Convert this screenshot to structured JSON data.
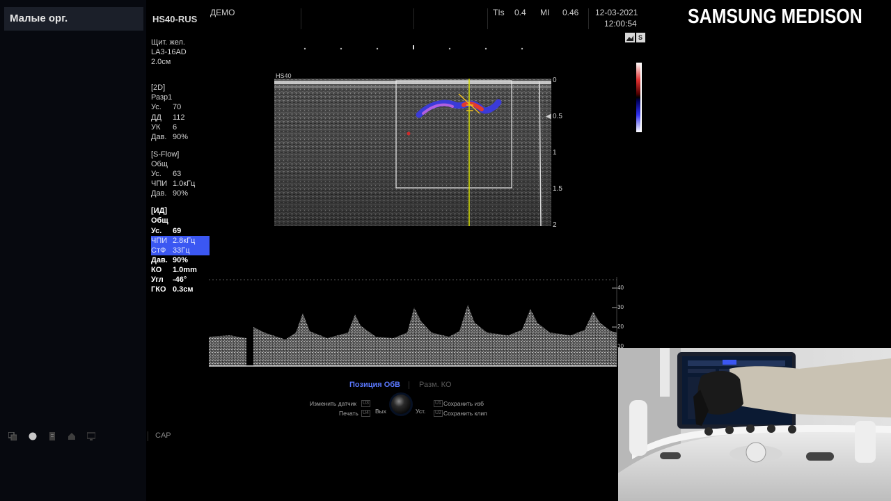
{
  "sidebar": {
    "preset": "Малые орг."
  },
  "header": {
    "model": "HS40-RUS",
    "mode": "ДЕМО",
    "tis_label": "TIs",
    "tis_value": "0.4",
    "mi_label": "MI",
    "mi_value": "0.46",
    "date": "12-03-2021",
    "time": "12:00:54",
    "image_label": "HS40"
  },
  "brand": {
    "logo": "SAMSUNG MEDISON"
  },
  "exam": {
    "organ": "Щит. жел.",
    "probe": "LA3-16AD",
    "depth": "2.0см"
  },
  "params": {
    "b2d": {
      "title": "[2D]",
      "line1": "Разр1",
      "rows": [
        {
          "k": "Ус.",
          "v": "70"
        },
        {
          "k": "ДД",
          "v": "112"
        },
        {
          "k": "УК",
          "v": "6"
        },
        {
          "k": "Дав.",
          "v": "90%"
        }
      ]
    },
    "sflow": {
      "title": "[S-Flow]",
      "line1": "Общ",
      "rows": [
        {
          "k": "Ус.",
          "v": "63"
        },
        {
          "k": "ЧПИ",
          "v": "1.0кГц"
        },
        {
          "k": "Дав.",
          "v": "90%"
        }
      ]
    },
    "pw": {
      "title": "[ИД]",
      "line1": "Общ",
      "rows": [
        {
          "k": "Ус.",
          "v": "69"
        },
        {
          "k": "ЧПИ",
          "v": "2.8кГц"
        },
        {
          "k": "СтФ",
          "v": "33Гц"
        },
        {
          "k": "Дав.",
          "v": "90%"
        },
        {
          "k": "КО",
          "v": "1.0mm"
        },
        {
          "k": "Угл",
          "v": "-46°"
        },
        {
          "k": "ГКО",
          "v": "0.3см"
        }
      ]
    }
  },
  "depth_scale": [
    "0",
    "0.5",
    "1",
    "1.5",
    "2"
  ],
  "velocity_scale": [
    "40",
    "30",
    "20",
    "10"
  ],
  "bottom_bar": {
    "cap": "CAP"
  },
  "controls": {
    "active": "Позиция ОбВ",
    "inactive": "Разм. КО",
    "change_probe": "Изменить датчик",
    "change_probe_key": "U3",
    "print": "Печать",
    "print_key": "U4",
    "exit": "Вых",
    "set": "Уст.",
    "save_image": "Сохранить изб",
    "save_image_key": "U1",
    "save_clip": "Сохранить клип",
    "save_clip_key": "U2"
  },
  "colors": {
    "accent": "#3b57f2",
    "active_text": "#5a78ff",
    "doppler_red": "#e0303a",
    "doppler_blue": "#3a3af0",
    "baseline": "#d6e000"
  },
  "icons": [
    "layers-icon",
    "record-icon",
    "file-icon",
    "printer-icon",
    "monitor-icon",
    "trackball-icon"
  ]
}
